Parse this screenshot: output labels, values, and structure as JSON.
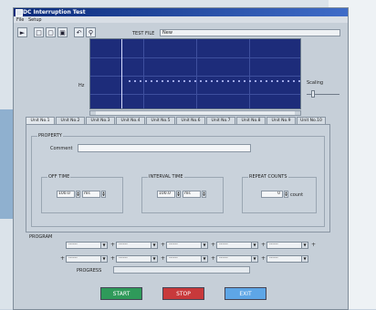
{
  "window": {
    "title": "DC Interruption Test"
  },
  "menu": [
    "File",
    "Setup"
  ],
  "toolbar": {
    "icons": [
      "input-icon",
      "new-icon",
      "open-icon",
      "save-icon",
      "undo-icon",
      "zoom-icon"
    ],
    "testfile_label": "TEST FILE",
    "testfile_value": "New"
  },
  "graph": {
    "ylabel": "Hz",
    "bg_color": "#1d2c7a"
  },
  "zoom": {
    "label": "Scaling",
    "level": 0.15
  },
  "tabs": [
    "Unit No.1",
    "Unit No.2",
    "Unit No.3",
    "Unit No.4",
    "Unit No.5",
    "Unit No.6",
    "Unit No.7",
    "Unit No.8",
    "Unit No.9",
    "Unit No.10"
  ],
  "panel": {
    "property_label": "PROPERTY",
    "comment_label": "Comment",
    "comment_value": "",
    "offtime": {
      "label": "OFF TIME",
      "value": "100.0",
      "unit": "ms"
    },
    "interval": {
      "label": "INTERVAL TIME",
      "value": "100.0",
      "unit": "ms"
    },
    "repeat": {
      "label": "REPEAT COUNTS",
      "value": "0",
      "unit": "count"
    }
  },
  "program": {
    "label": "PROGRAM",
    "row1": [
      "------",
      "------",
      "------",
      "------",
      "------"
    ],
    "row2": [
      "------",
      "------",
      "------",
      "------",
      "------"
    ]
  },
  "progress": {
    "label": "PROGRESS",
    "fraction": 0.0
  },
  "buttons": {
    "start": "START",
    "stop": "STOP",
    "exit": "EXIT"
  },
  "colors": {
    "start": "#2f9a5a",
    "stop": "#c8393b",
    "exit": "#5ea6e6"
  }
}
